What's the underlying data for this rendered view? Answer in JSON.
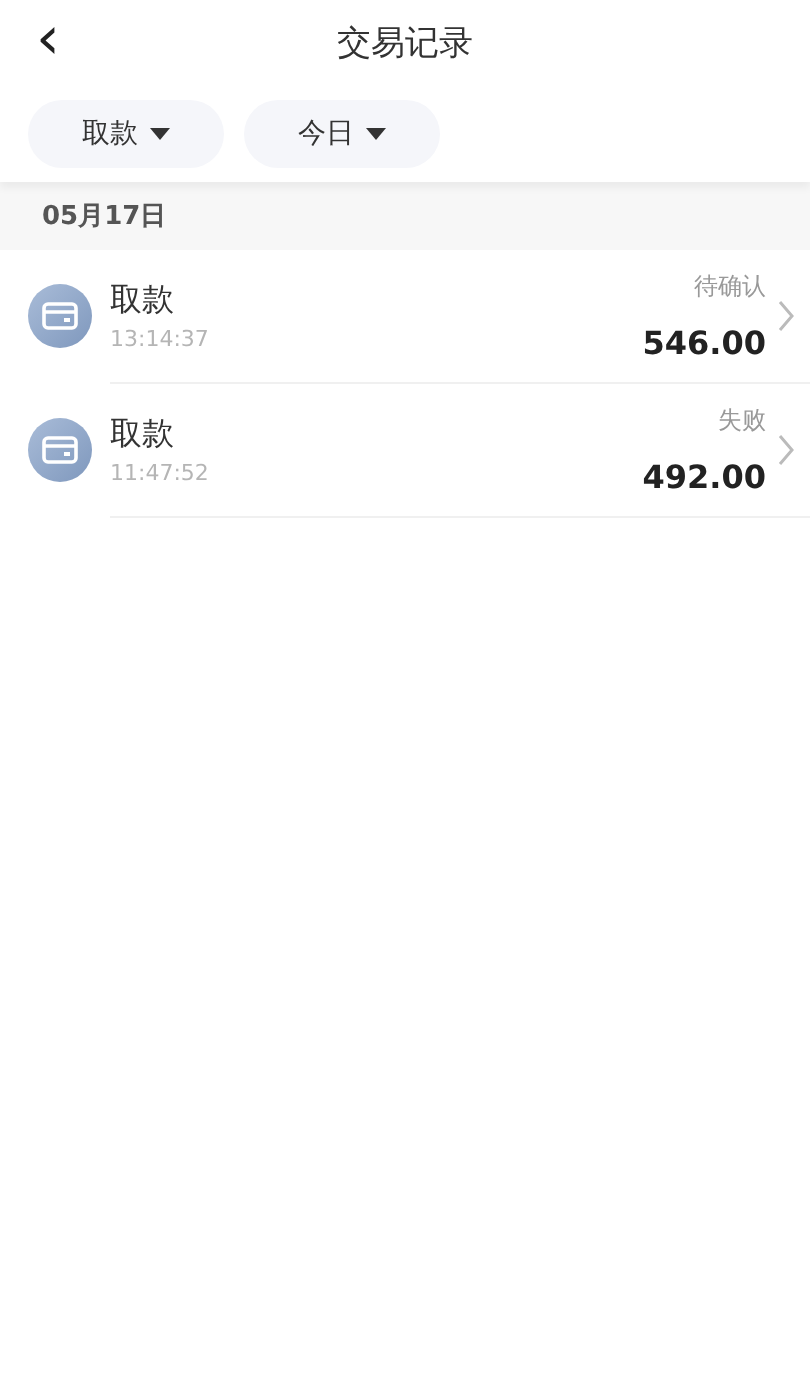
{
  "header": {
    "back": "‹",
    "title": "交易记录"
  },
  "filters": [
    {
      "label": "取款"
    },
    {
      "label": "今日"
    }
  ],
  "groups": [
    {
      "date": "05月17日",
      "transactions": [
        {
          "title": "取款",
          "time": "13:14:37",
          "status": "待确认",
          "amount": "546.00"
        },
        {
          "title": "取款",
          "time": "11:47:52",
          "status": "失败",
          "amount": "492.00"
        }
      ]
    }
  ]
}
